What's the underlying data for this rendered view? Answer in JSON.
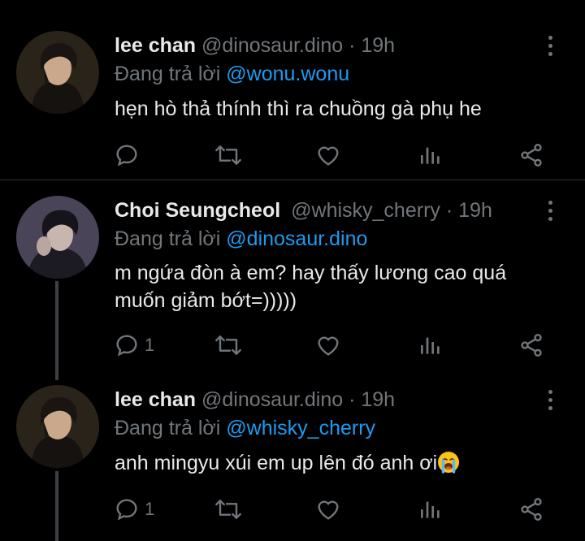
{
  "tweets": [
    {
      "name": "lee chan",
      "handle": "@dinosaur.dino",
      "sep": "·",
      "time": "19h",
      "reply_prefix": "Đang trả lời ",
      "reply_to": "@wonu.wonu",
      "text": "hẹn hò thả thính thì ra chuồng gà phụ he",
      "reply_count": ""
    },
    {
      "name": "Choi Seungcheol",
      "handle": "@whisky_cherry",
      "sep": "·",
      "time": "19h",
      "reply_prefix": "Đang trả lời ",
      "reply_to": "@dinosaur.dino",
      "text": "m ngứa đòn à em? hay thấy lương cao quá muốn giảm bớt=)))))",
      "reply_count": "1"
    },
    {
      "name": "lee chan",
      "handle": "@dinosaur.dino",
      "sep": "·",
      "time": "19h",
      "reply_prefix": "Đang trả lời ",
      "reply_to": "@whisky_cherry",
      "text": "anh mingyu xúi em up lên đó anh ơi",
      "reply_count": "1"
    }
  ],
  "icons": {
    "reply": "reply-icon",
    "retweet": "retweet-icon",
    "like": "heart-icon",
    "views": "analytics-icon",
    "share": "share-icon",
    "more": "more-vertical-icon",
    "emoji": "crying-face-emoji"
  },
  "colors": {
    "background": "#000000",
    "text": "#e7e9ea",
    "muted": "#71767b",
    "link": "#1d9bf0",
    "divider": "#2f3336"
  }
}
